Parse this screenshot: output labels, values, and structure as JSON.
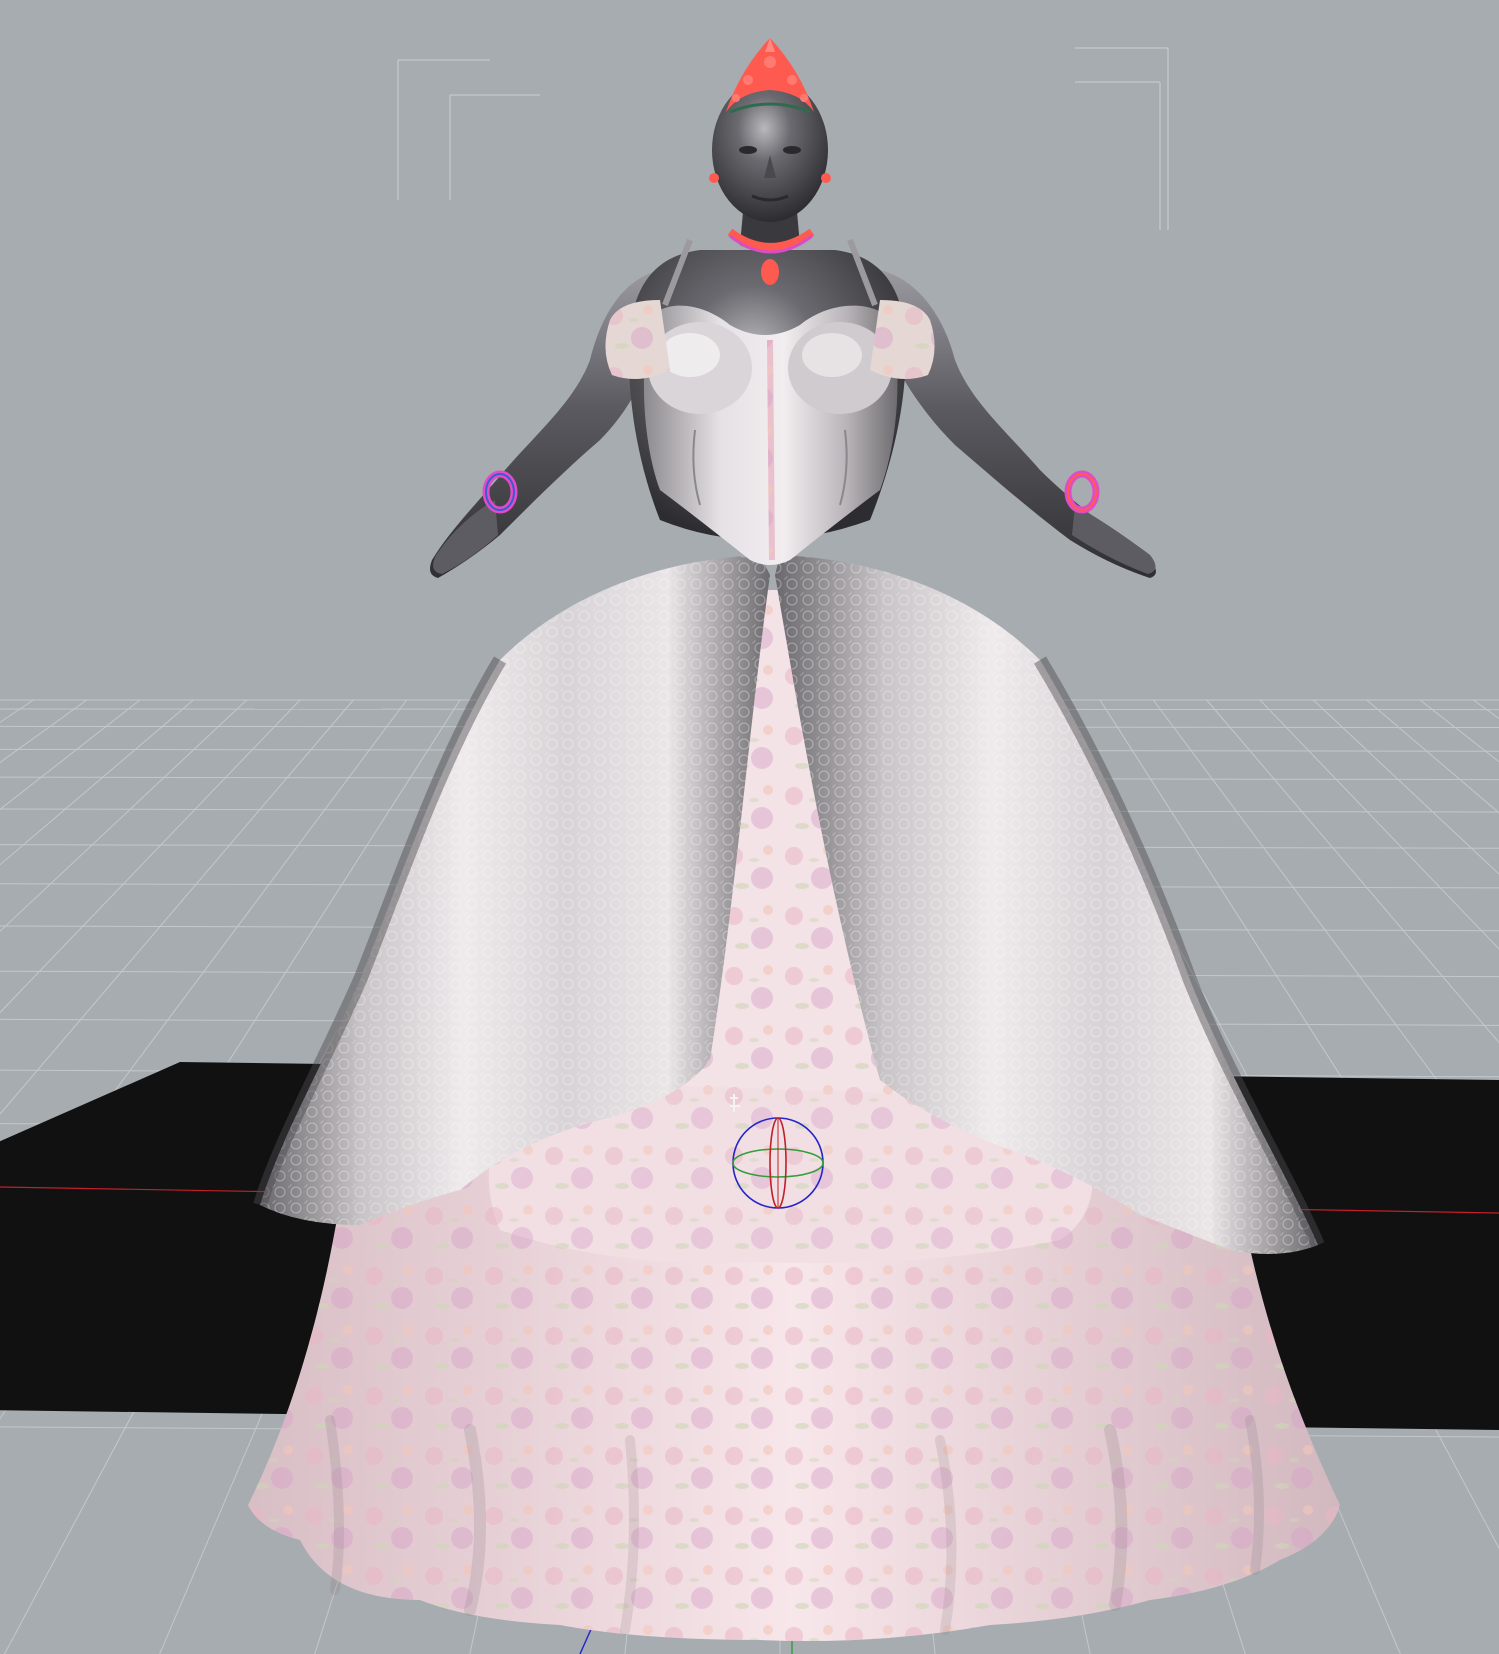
{
  "viewport": {
    "mode": "3d-perspective",
    "background_color": "#a6acb0",
    "grid_color": "#c3c8cc",
    "ground_plane_color": "#111111",
    "axis_colors": {
      "x": "#c0202a",
      "y": "#2f9f3a",
      "z": "#2424c8"
    }
  },
  "scene": {
    "figure": {
      "name": "figure",
      "pose": "A-pose",
      "skin_color": "#4a4a4e"
    },
    "props": [
      {
        "name": "tiara",
        "color": "#ff5a50"
      },
      {
        "name": "necklace",
        "color": "#ff5a50"
      },
      {
        "name": "earrings",
        "color": "#ff5a50"
      },
      {
        "name": "bracelets",
        "color": "#e04cc8"
      }
    ],
    "garment": {
      "name": "ball-gown",
      "bodice_color": "#d9d3d6",
      "overskirt_color": "#c9c5c8",
      "underskirt_color": "#f2dde2",
      "print_colors": [
        "#e9b6c4",
        "#d7a2c9",
        "#f3c7b9",
        "#cfd6b8"
      ]
    },
    "manipulator": {
      "name": "universal-manipulator",
      "gizmo_colors": [
        "#2424c8",
        "#c0202a",
        "#2f9f3a"
      ]
    },
    "camera_frames": [
      {
        "name": "left-camera-frame"
      },
      {
        "name": "right-camera-frame"
      }
    ]
  }
}
